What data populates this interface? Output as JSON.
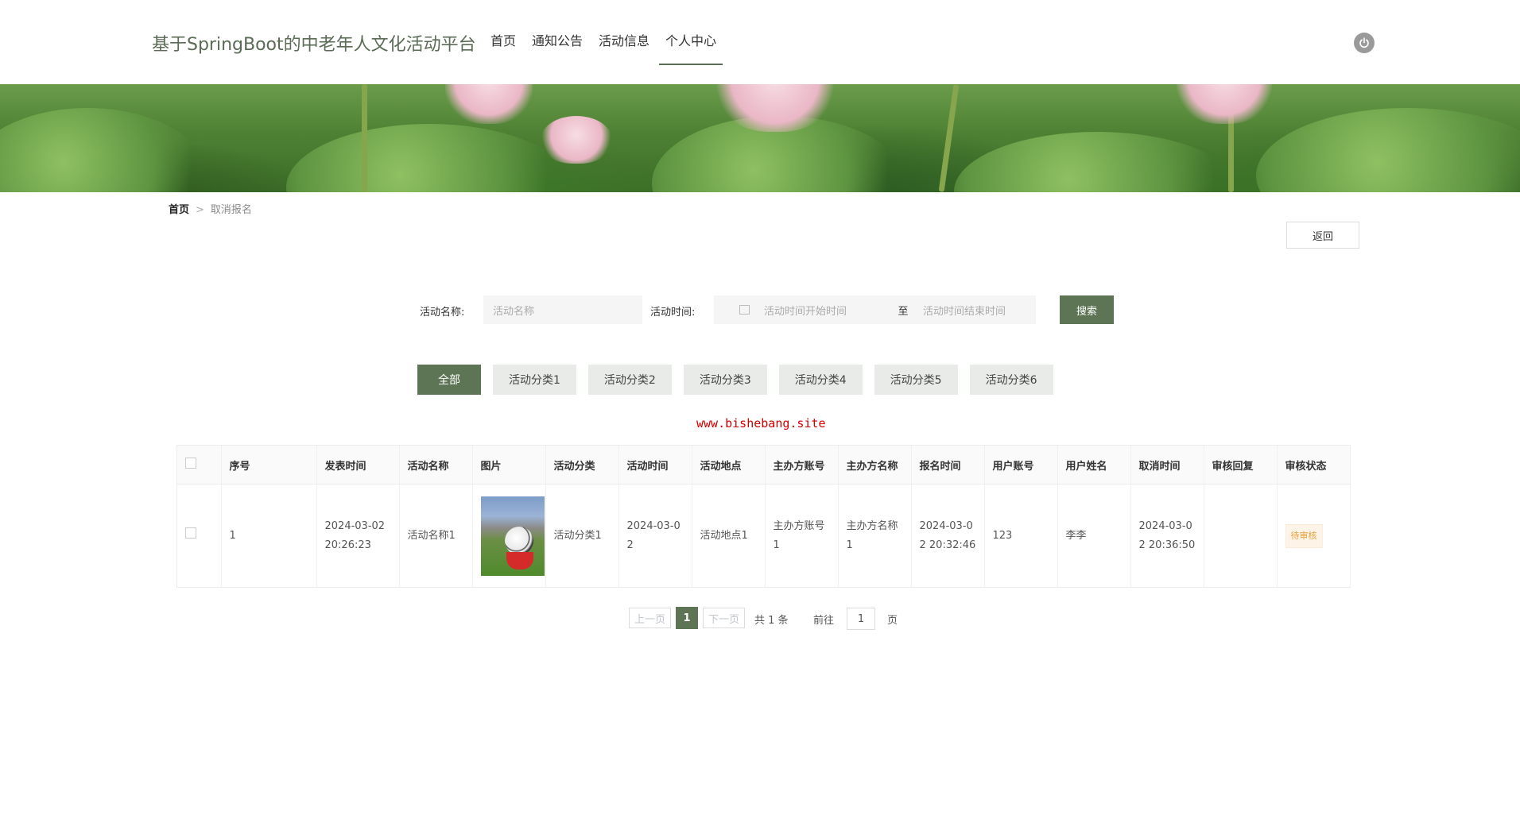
{
  "header": {
    "site_title": "基于SpringBoot的中老年人文化活动平台",
    "nav": [
      "首页",
      "通知公告",
      "活动信息",
      "个人中心"
    ],
    "active_nav": "个人中心",
    "power_icon": "power-icon"
  },
  "breadcrumb": {
    "home": "首页",
    "separator": ">",
    "current": "取消报名"
  },
  "back_label": "返回",
  "search": {
    "name_label": "活动名称:",
    "name_placeholder": "活动名称",
    "time_label": "活动时间:",
    "time_start_placeholder": "活动时间开始时间",
    "time_to": "至",
    "time_end_placeholder": "活动时间结束时间",
    "button": "搜索"
  },
  "categories": [
    "全部",
    "活动分类1",
    "活动分类2",
    "活动分类3",
    "活动分类4",
    "活动分类5",
    "活动分类6"
  ],
  "active_category": "全部",
  "watermark": "www.bishebang.site",
  "table": {
    "headers": [
      "序号",
      "发表时间",
      "活动名称",
      "图片",
      "活动分类",
      "活动时间",
      "活动地点",
      "主办方账号",
      "主办方名称",
      "报名时间",
      "用户账号",
      "用户姓名",
      "取消时间",
      "审核回复",
      "审核状态"
    ],
    "rows": [
      {
        "index": "1",
        "publish_time": "2024-03-02 20:26:23",
        "name": "活动名称1",
        "category": "活动分类1",
        "activity_time": "2024-03-02",
        "location": "活动地点1",
        "host_account": "主办方账号1",
        "host_name": "主办方名称1",
        "signup_time": "2024-03-02 20:32:46",
        "user_account": "123",
        "user_name": "李李",
        "cancel_time": "2024-03-02 20:36:50",
        "review_reply": "",
        "review_status": "待审核"
      }
    ]
  },
  "pagination": {
    "prev": "上一页",
    "current": "1",
    "next": "下一页",
    "total": "共 1 条",
    "goto": "前往",
    "page_input": "1",
    "page_unit": "页"
  },
  "colors": {
    "accent": "#5d7555",
    "title": "#5a6b56",
    "warning": "#e6a23c",
    "watermark": "#d10000"
  }
}
